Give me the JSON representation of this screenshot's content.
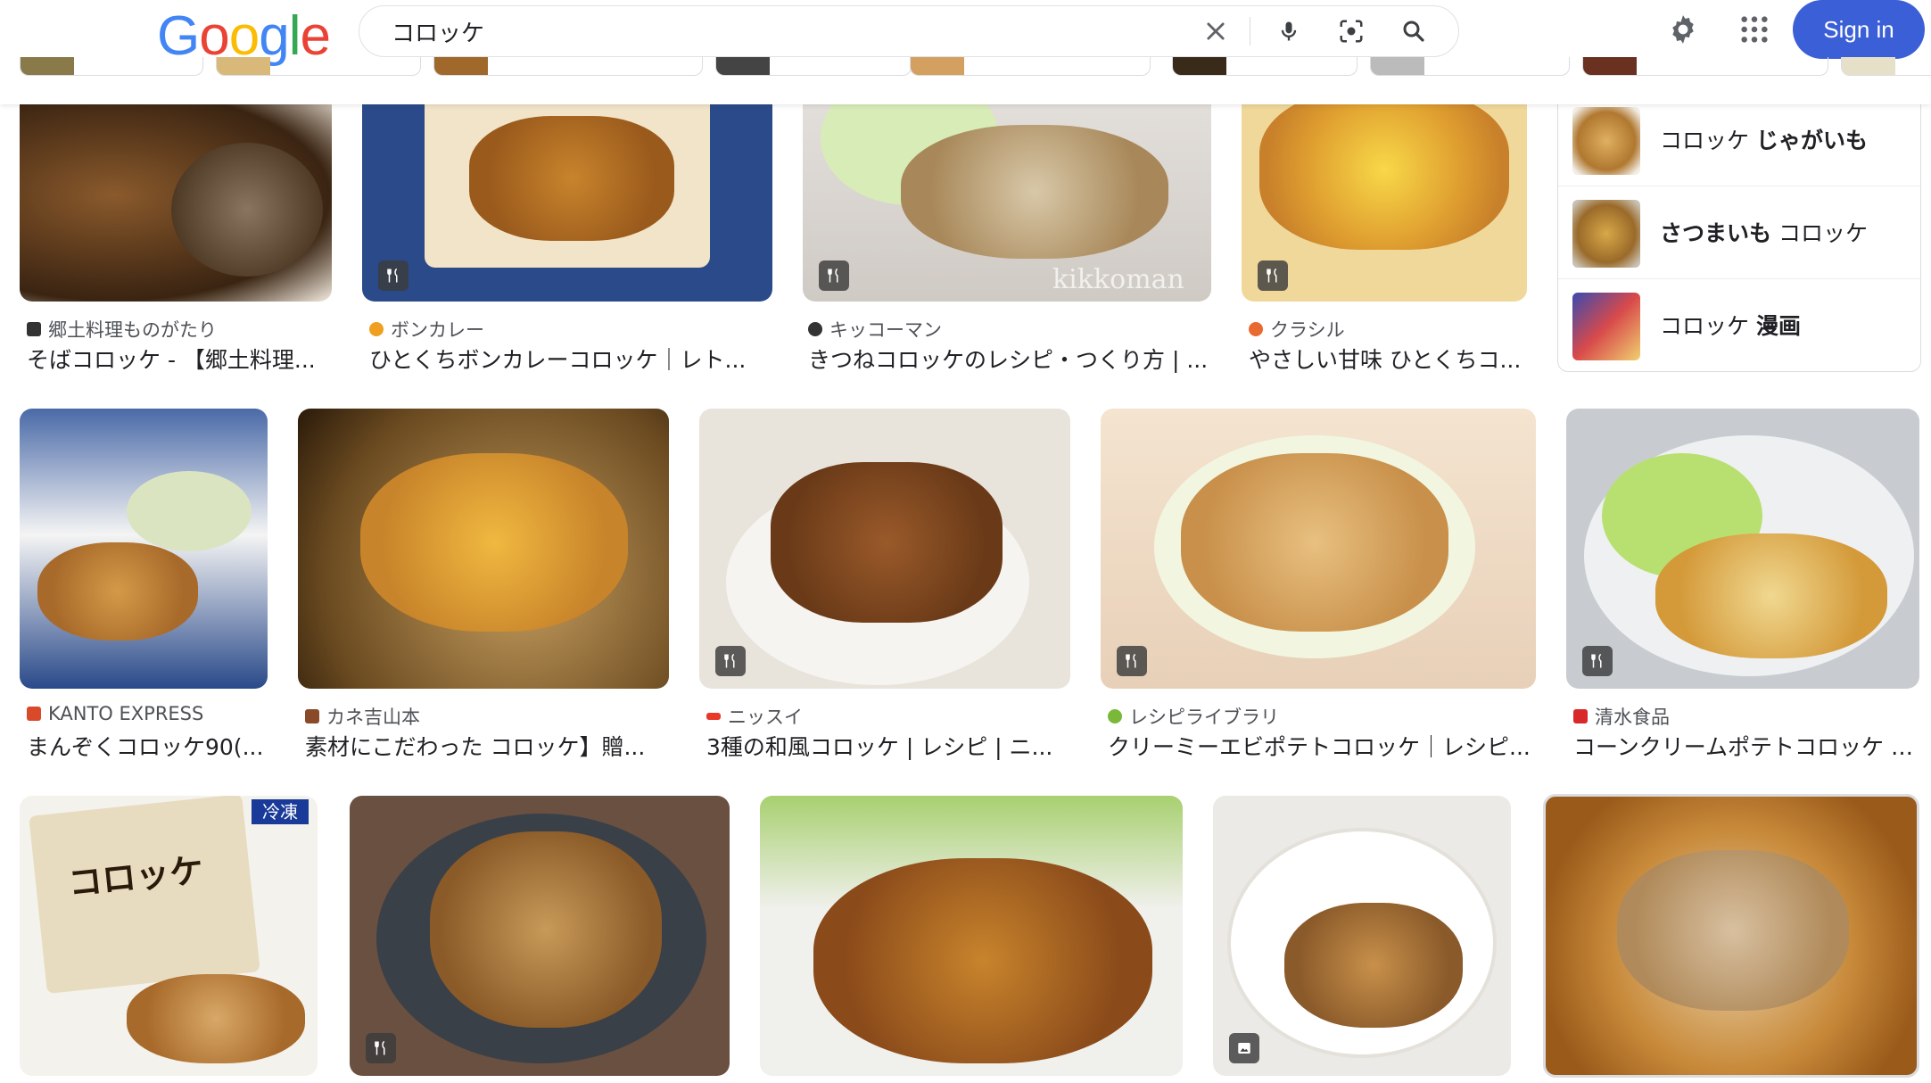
{
  "header": {
    "logo": [
      "G",
      "o",
      "o",
      "g",
      "l",
      "e"
    ],
    "logo_colors": [
      "#4285f4",
      "#ea4335",
      "#fbbc05",
      "#4285f4",
      "#34a853",
      "#ea4335"
    ],
    "query": "コロッケ",
    "sign_in": "Sign in"
  },
  "icons": {
    "clear": "close-icon",
    "voice": "microphone-icon",
    "lens": "camera-lens-icon",
    "search": "search-icon",
    "settings": "gear-icon",
    "apps": "apps-grid-icon"
  },
  "colors": {
    "signin_bg": "#3b5fd6",
    "badge_bg": "#3c3c3c"
  },
  "row1": [
    {
      "source": "郷土料理ものがたり",
      "title": "そばコロッケ - 【郷土料理..."
    },
    {
      "source": "ボンカレー",
      "title": "ひとくちボンカレーコロッケ｜レト..."
    },
    {
      "source": "キッコーマン",
      "title": "きつねコロッケのレシピ・つくり方 | ..."
    },
    {
      "source": "クラシル",
      "title": "やさしい甘味 ひとくちコ..."
    }
  ],
  "related": [
    {
      "plain": "コロッケ ",
      "bold": "じゃがいも",
      "order": "plain-first"
    },
    {
      "plain": " コロッケ",
      "bold": "さつまいも",
      "order": "bold-first"
    },
    {
      "plain": "コロッケ ",
      "bold": "漫画",
      "order": "plain-first"
    }
  ],
  "row2": [
    {
      "source": "KANTO EXPRESS",
      "title": "まんぞくコロッケ90(..."
    },
    {
      "source": "カネ吉山本",
      "title": "素材にこだわった コロッケ】贈..."
    },
    {
      "source": "ニッスイ",
      "title": "3種の和風コロッケ | レシピ | ニ..."
    },
    {
      "source": "レシピライブラリ",
      "title": "クリーミーエビポテトコロッケ｜レシピ..."
    },
    {
      "source": "清水食品",
      "title": "コーンクリームポテトコロッケ |..."
    }
  ],
  "row3": {
    "package_badge": "冷凍",
    "package_label": "コロッケ"
  },
  "image_watermark": "kikkoman"
}
